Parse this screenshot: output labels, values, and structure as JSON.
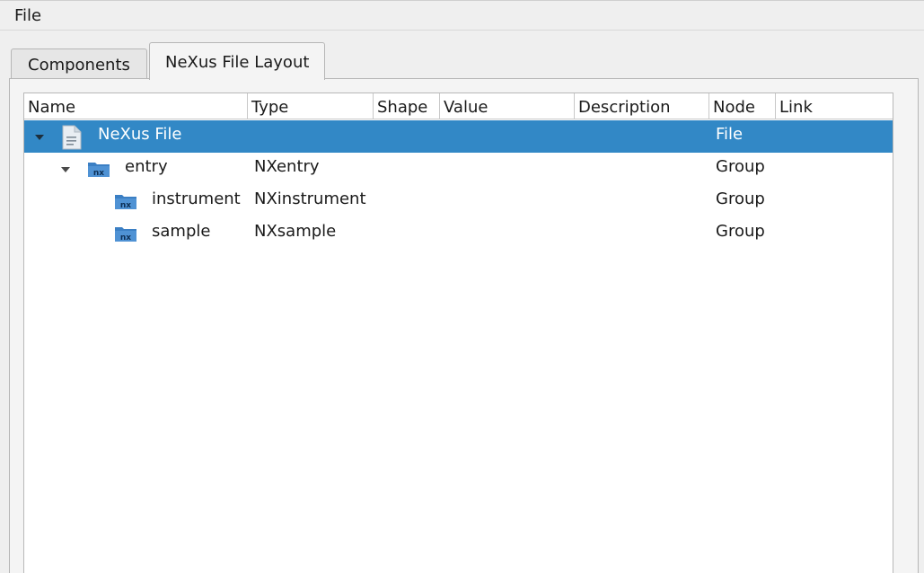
{
  "menubar": {
    "file_label": "File"
  },
  "tabs": [
    {
      "label": "Components",
      "active": false
    },
    {
      "label": "NeXus File Layout",
      "active": true
    }
  ],
  "tree": {
    "columns": [
      "Name",
      "Type",
      "Shape",
      "Value",
      "Description",
      "Node",
      "Link"
    ],
    "rows": [
      {
        "name": "NeXus File",
        "type": "",
        "shape": "",
        "value": "",
        "description": "",
        "node": "File",
        "link": "",
        "icon": "document-icon",
        "expanded": true,
        "selected": true
      },
      {
        "name": "entry",
        "type": "NXentry",
        "shape": "",
        "value": "",
        "description": "",
        "node": "Group",
        "link": "",
        "icon": "nx-folder-icon",
        "expanded": true,
        "selected": false
      },
      {
        "name": "instrument",
        "type": "NXinstrument",
        "shape": "",
        "value": "",
        "description": "",
        "node": "Group",
        "link": "",
        "icon": "nx-folder-icon",
        "selected": false
      },
      {
        "name": "sample",
        "type": "NXsample",
        "shape": "",
        "value": "",
        "description": "",
        "node": "Group",
        "link": "",
        "icon": "nx-folder-icon",
        "selected": false
      }
    ]
  },
  "colors": {
    "selection": "#3288c6",
    "nx_icon": "#3b7fc4"
  }
}
